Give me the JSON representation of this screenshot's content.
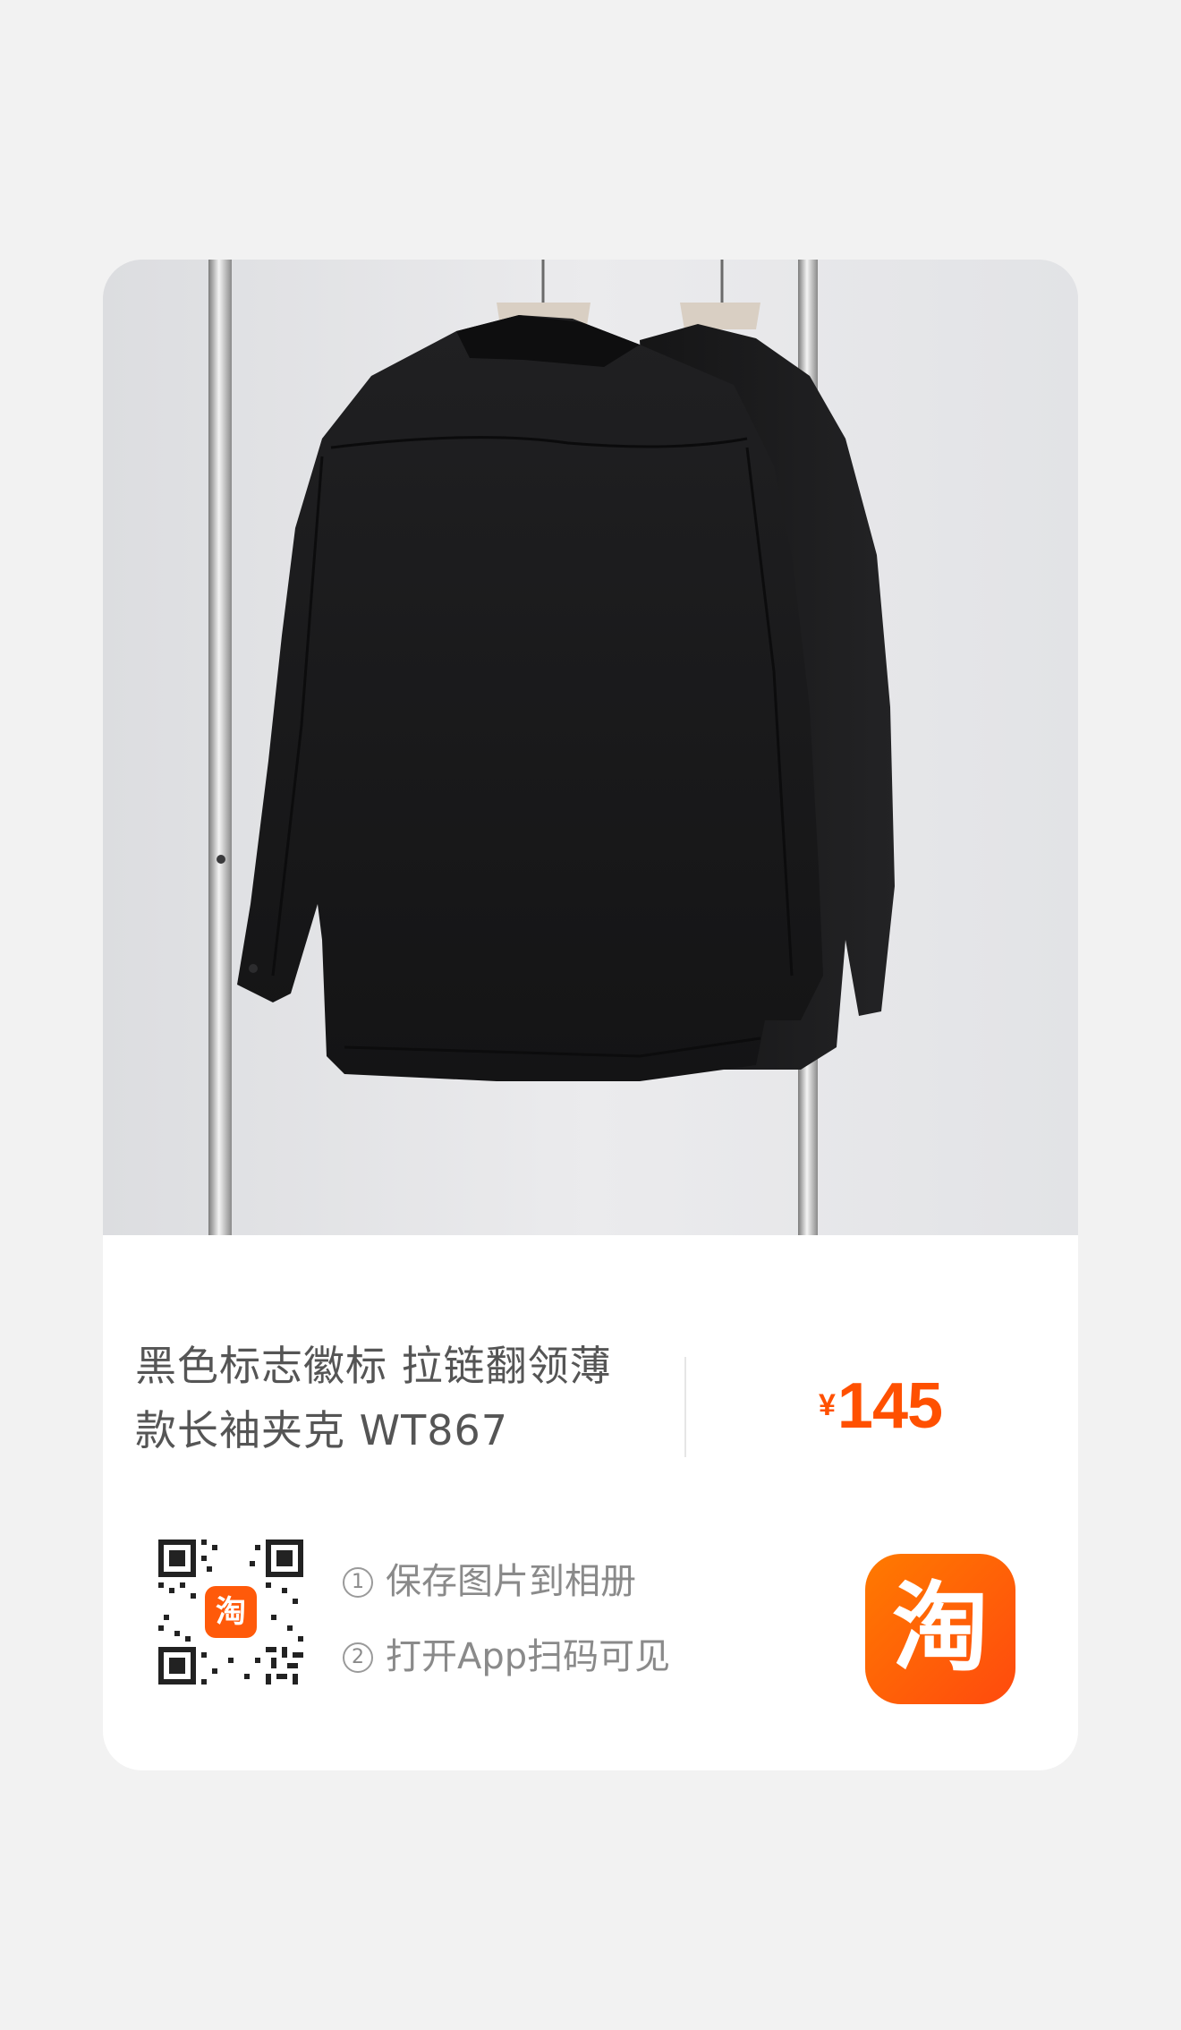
{
  "product": {
    "title_line1": "黑色标志徽标 拉链翻领薄",
    "title_line2": "款长袖夹克 WT867",
    "currency": "¥",
    "price": "145"
  },
  "share": {
    "qr_logo_char": "淘",
    "step1_num": "1",
    "step1_text": "保存图片到相册",
    "step2_num": "2",
    "step2_text": "打开App扫码可见",
    "app_icon_char": "淘"
  },
  "colors": {
    "accent": "#ff5000",
    "text": "#555555",
    "secondary_text": "#8a8a8a",
    "background": "#f2f2f2"
  }
}
